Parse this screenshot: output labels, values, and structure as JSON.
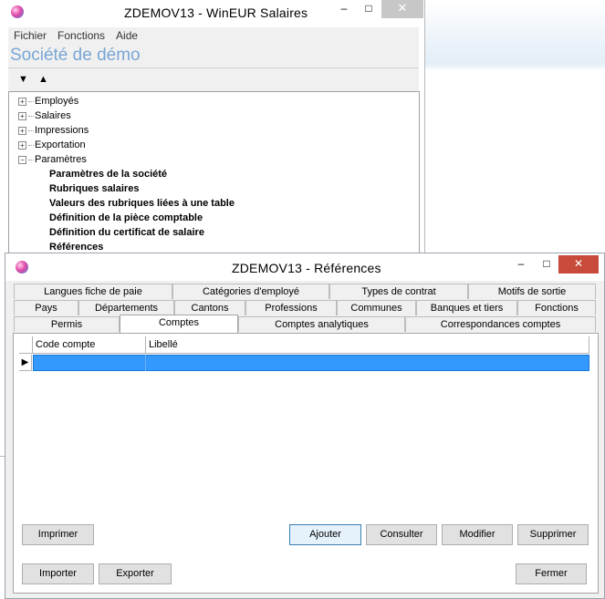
{
  "main_window": {
    "title": "ZDEMOV13 - WinEUR Salaires",
    "minimize": "–",
    "maximize": "□",
    "close": "✕",
    "menu": [
      "Fichier",
      "Fonctions",
      "Aide"
    ],
    "company": "Société de démo",
    "arrow_down": "▼",
    "arrow_up": "▲",
    "tree": {
      "root": [
        {
          "label": "Employés",
          "sign": "+"
        },
        {
          "label": "Salaires",
          "sign": "+"
        },
        {
          "label": "Impressions",
          "sign": "+"
        },
        {
          "label": "Exportation",
          "sign": "+"
        },
        {
          "label": "Paramètres",
          "sign": "−"
        }
      ],
      "children": [
        "Paramètres de la société",
        "Rubriques salaires",
        "Valeurs des rubriques liées à une table",
        "Définition de la pièce comptable",
        "Définition du certificat de salaire",
        "Références"
      ]
    }
  },
  "ref_window": {
    "title": "ZDEMOV13 - Références",
    "minimize": "–",
    "maximize": "□",
    "close": "✕",
    "tabs_row1": [
      "Langues fiche de paie",
      "Catégories d'employé",
      "Types de contrat",
      "Motifs de sortie"
    ],
    "tabs_row2": [
      "Pays",
      "Départements",
      "Cantons",
      "Professions",
      "Communes",
      "Banques et tiers",
      "Fonctions"
    ],
    "tabs_row3": [
      "Permis",
      "Comptes",
      "Comptes analytiques",
      "Correspondances comptes"
    ],
    "active_tab": "Comptes",
    "grid": {
      "columns": [
        "Code compte",
        "Libellé"
      ],
      "row_indicator": "▶"
    },
    "buttons": {
      "imprimer": "Imprimer",
      "ajouter": "Ajouter",
      "consulter": "Consulter",
      "modifier": "Modifier",
      "supprimer": "Supprimer",
      "importer": "Importer",
      "exporter": "Exporter",
      "fermer": "Fermer"
    }
  }
}
